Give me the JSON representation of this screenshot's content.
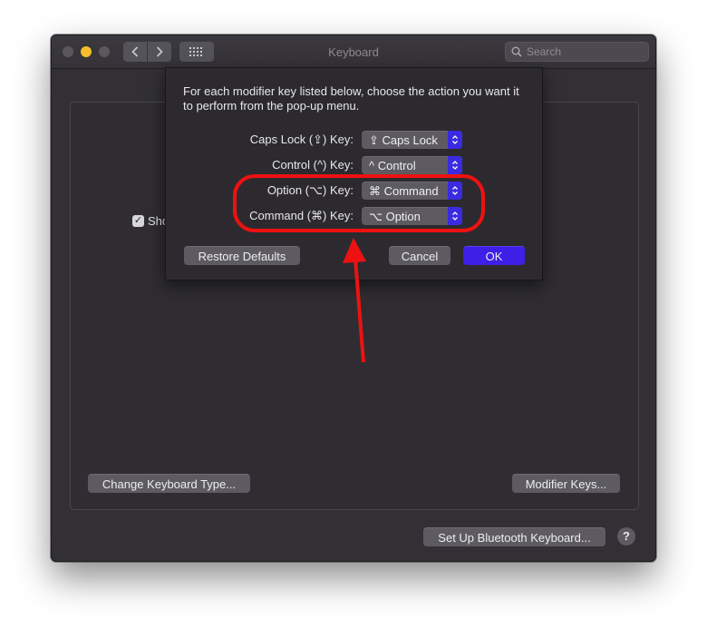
{
  "window": {
    "title": "Keyboard",
    "search_placeholder": "Search"
  },
  "background": {
    "checkbox_label": "Sho"
  },
  "buttons": {
    "change_keyboard_type": "Change Keyboard Type...",
    "modifier_keys": "Modifier Keys...",
    "bluetooth": "Set Up Bluetooth Keyboard...",
    "help": "?"
  },
  "sheet": {
    "instructions": "For each modifier key listed below, choose the action you want it to perform from the pop-up menu.",
    "rows": [
      {
        "label": "Caps Lock (⇪) Key:",
        "value": "⇪ Caps Lock"
      },
      {
        "label": "Control (^) Key:",
        "value": "^ Control"
      },
      {
        "label": "Option (⌥) Key:",
        "value": "⌘ Command"
      },
      {
        "label": "Command (⌘) Key:",
        "value": "⌥ Option"
      }
    ],
    "restore_defaults": "Restore Defaults",
    "cancel": "Cancel",
    "ok": "OK"
  },
  "colors": {
    "accent": "#3d1fe8",
    "annotation": "#ee1111",
    "minimize": "#f5bd2b"
  },
  "icons": [
    "chevron-left-icon",
    "chevron-right-icon",
    "grid-icon",
    "search-icon",
    "up-down-arrows-icon",
    "checkmark-icon",
    "help-icon"
  ]
}
